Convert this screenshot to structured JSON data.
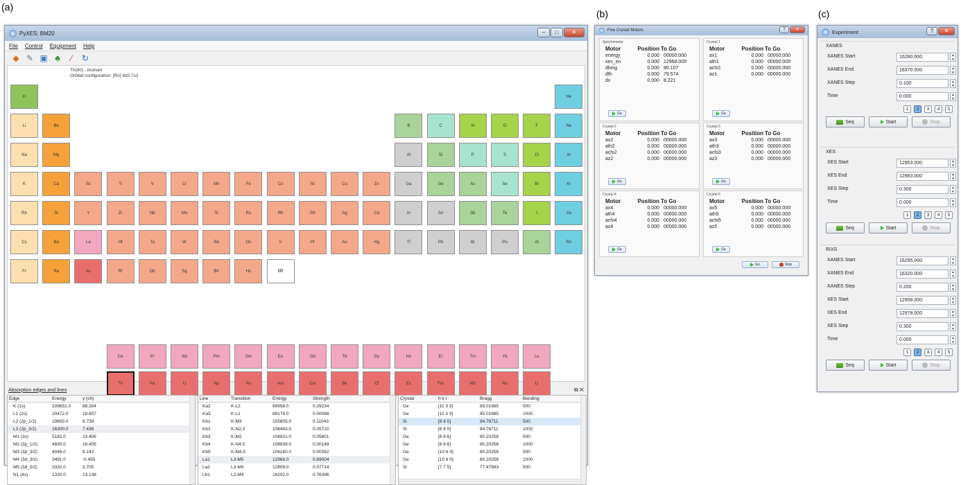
{
  "labels": {
    "a": "(a)",
    "b": "(b)",
    "c": "(c)"
  },
  "main": {
    "title": "PyXES: BM20",
    "menu": [
      "File",
      "Control",
      "Equipment",
      "Help"
    ],
    "info_line1": "Th(90) - thorium",
    "info_line2": "Orbital configuration: [Rn] 6d2 7s2",
    "dock_title": "Absorption edges and lines",
    "colors": {
      "h": "#8fc25a",
      "alkali": "#fde0b0",
      "alkaline": "#f5a23b",
      "tm": "#f4a88a",
      "post": "#cfcfcf",
      "metalloid": "#a9d39b",
      "nonmetal": "#a8e3d0",
      "halogen": "#a7d34a",
      "noble": "#6fcfe0",
      "lan": "#f1a8bf",
      "act": "#e96f6f",
      "sc": "#f1b0a0"
    },
    "elements": [
      {
        "s": "H",
        "r": 0,
        "c": 0,
        "g": "h"
      },
      {
        "s": "He",
        "r": 0,
        "c": 17,
        "g": "noble"
      },
      {
        "s": "Li",
        "r": 1,
        "c": 0,
        "g": "alkali"
      },
      {
        "s": "Be",
        "r": 1,
        "c": 1,
        "g": "alkaline"
      },
      {
        "s": "B",
        "r": 1,
        "c": 12,
        "g": "metalloid"
      },
      {
        "s": "C",
        "r": 1,
        "c": 13,
        "g": "nonmetal"
      },
      {
        "s": "N",
        "r": 1,
        "c": 14,
        "g": "halogen"
      },
      {
        "s": "O",
        "r": 1,
        "c": 15,
        "g": "halogen"
      },
      {
        "s": "F",
        "r": 1,
        "c": 16,
        "g": "halogen"
      },
      {
        "s": "Ne",
        "r": 1,
        "c": 17,
        "g": "noble"
      },
      {
        "s": "Na",
        "r": 2,
        "c": 0,
        "g": "alkali"
      },
      {
        "s": "Mg",
        "r": 2,
        "c": 1,
        "g": "alkaline"
      },
      {
        "s": "Al",
        "r": 2,
        "c": 12,
        "g": "post"
      },
      {
        "s": "Si",
        "r": 2,
        "c": 13,
        "g": "metalloid"
      },
      {
        "s": "P",
        "r": 2,
        "c": 14,
        "g": "nonmetal"
      },
      {
        "s": "S",
        "r": 2,
        "c": 15,
        "g": "nonmetal"
      },
      {
        "s": "Cl",
        "r": 2,
        "c": 16,
        "g": "halogen"
      },
      {
        "s": "Ar",
        "r": 2,
        "c": 17,
        "g": "noble"
      },
      {
        "s": "K",
        "r": 3,
        "c": 0,
        "g": "alkali"
      },
      {
        "s": "Ca",
        "r": 3,
        "c": 1,
        "g": "alkaline"
      },
      {
        "s": "Sc",
        "r": 3,
        "c": 2,
        "g": "tm"
      },
      {
        "s": "Ti",
        "r": 3,
        "c": 3,
        "g": "tm"
      },
      {
        "s": "V",
        "r": 3,
        "c": 4,
        "g": "tm"
      },
      {
        "s": "Cr",
        "r": 3,
        "c": 5,
        "g": "tm"
      },
      {
        "s": "Mn",
        "r": 3,
        "c": 6,
        "g": "tm"
      },
      {
        "s": "Fe",
        "r": 3,
        "c": 7,
        "g": "tm"
      },
      {
        "s": "Co",
        "r": 3,
        "c": 8,
        "g": "tm"
      },
      {
        "s": "Ni",
        "r": 3,
        "c": 9,
        "g": "tm"
      },
      {
        "s": "Cu",
        "r": 3,
        "c": 10,
        "g": "tm"
      },
      {
        "s": "Zn",
        "r": 3,
        "c": 11,
        "g": "tm"
      },
      {
        "s": "Ga",
        "r": 3,
        "c": 12,
        "g": "post"
      },
      {
        "s": "Ge",
        "r": 3,
        "c": 13,
        "g": "metalloid"
      },
      {
        "s": "As",
        "r": 3,
        "c": 14,
        "g": "metalloid"
      },
      {
        "s": "Se",
        "r": 3,
        "c": 15,
        "g": "nonmetal"
      },
      {
        "s": "Br",
        "r": 3,
        "c": 16,
        "g": "halogen"
      },
      {
        "s": "Kr",
        "r": 3,
        "c": 17,
        "g": "noble"
      },
      {
        "s": "Rb",
        "r": 4,
        "c": 0,
        "g": "alkali"
      },
      {
        "s": "Sr",
        "r": 4,
        "c": 1,
        "g": "alkaline"
      },
      {
        "s": "Y",
        "r": 4,
        "c": 2,
        "g": "tm"
      },
      {
        "s": "Zr",
        "r": 4,
        "c": 3,
        "g": "tm"
      },
      {
        "s": "Nb",
        "r": 4,
        "c": 4,
        "g": "tm"
      },
      {
        "s": "Mo",
        "r": 4,
        "c": 5,
        "g": "tm"
      },
      {
        "s": "Tc",
        "r": 4,
        "c": 6,
        "g": "tm"
      },
      {
        "s": "Ru",
        "r": 4,
        "c": 7,
        "g": "tm"
      },
      {
        "s": "Rh",
        "r": 4,
        "c": 8,
        "g": "tm"
      },
      {
        "s": "Pd",
        "r": 4,
        "c": 9,
        "g": "tm"
      },
      {
        "s": "Ag",
        "r": 4,
        "c": 10,
        "g": "tm"
      },
      {
        "s": "Cd",
        "r": 4,
        "c": 11,
        "g": "tm"
      },
      {
        "s": "In",
        "r": 4,
        "c": 12,
        "g": "post"
      },
      {
        "s": "Sn",
        "r": 4,
        "c": 13,
        "g": "post"
      },
      {
        "s": "Sb",
        "r": 4,
        "c": 14,
        "g": "metalloid"
      },
      {
        "s": "Te",
        "r": 4,
        "c": 15,
        "g": "metalloid"
      },
      {
        "s": "I",
        "r": 4,
        "c": 16,
        "g": "halogen"
      },
      {
        "s": "Xe",
        "r": 4,
        "c": 17,
        "g": "noble"
      },
      {
        "s": "Cs",
        "r": 5,
        "c": 0,
        "g": "alkali"
      },
      {
        "s": "Ba",
        "r": 5,
        "c": 1,
        "g": "alkaline"
      },
      {
        "s": "La",
        "r": 5,
        "c": 2,
        "g": "lan"
      },
      {
        "s": "Hf",
        "r": 5,
        "c": 3,
        "g": "tm"
      },
      {
        "s": "Ta",
        "r": 5,
        "c": 4,
        "g": "tm"
      },
      {
        "s": "W",
        "r": 5,
        "c": 5,
        "g": "tm"
      },
      {
        "s": "Re",
        "r": 5,
        "c": 6,
        "g": "tm"
      },
      {
        "s": "Os",
        "r": 5,
        "c": 7,
        "g": "tm"
      },
      {
        "s": "Ir",
        "r": 5,
        "c": 8,
        "g": "tm"
      },
      {
        "s": "Pt",
        "r": 5,
        "c": 9,
        "g": "tm"
      },
      {
        "s": "Au",
        "r": 5,
        "c": 10,
        "g": "tm"
      },
      {
        "s": "Hg",
        "r": 5,
        "c": 11,
        "g": "tm"
      },
      {
        "s": "Tl",
        "r": 5,
        "c": 12,
        "g": "post"
      },
      {
        "s": "Pb",
        "r": 5,
        "c": 13,
        "g": "post"
      },
      {
        "s": "Bi",
        "r": 5,
        "c": 14,
        "g": "post"
      },
      {
        "s": "Po",
        "r": 5,
        "c": 15,
        "g": "post"
      },
      {
        "s": "At",
        "r": 5,
        "c": 16,
        "g": "metalloid"
      },
      {
        "s": "Rn",
        "r": 5,
        "c": 17,
        "g": "noble"
      },
      {
        "s": "Fr",
        "r": 6,
        "c": 0,
        "g": "alkali"
      },
      {
        "s": "Ra",
        "r": 6,
        "c": 1,
        "g": "alkaline"
      },
      {
        "s": "Ac",
        "r": 6,
        "c": 2,
        "g": "act"
      },
      {
        "s": "Rf",
        "r": 6,
        "c": 3,
        "g": "tm"
      },
      {
        "s": "Db",
        "r": 6,
        "c": 4,
        "g": "tm"
      },
      {
        "s": "Sg",
        "r": 6,
        "c": 5,
        "g": "tm"
      },
      {
        "s": "Bh",
        "r": 6,
        "c": 6,
        "g": "tm"
      },
      {
        "s": "Hs",
        "r": 6,
        "c": 7,
        "g": "tm"
      },
      {
        "s": "Mt",
        "r": 6,
        "c": 8,
        "g": "empty"
      },
      {
        "s": "Ce",
        "r": 7,
        "c": 3,
        "g": "lan"
      },
      {
        "s": "Pr",
        "r": 7,
        "c": 4,
        "g": "lan"
      },
      {
        "s": "Nd",
        "r": 7,
        "c": 5,
        "g": "lan"
      },
      {
        "s": "Pm",
        "r": 7,
        "c": 6,
        "g": "lan"
      },
      {
        "s": "Sm",
        "r": 7,
        "c": 7,
        "g": "lan"
      },
      {
        "s": "Eu",
        "r": 7,
        "c": 8,
        "g": "lan"
      },
      {
        "s": "Gd",
        "r": 7,
        "c": 9,
        "g": "lan"
      },
      {
        "s": "Tb",
        "r": 7,
        "c": 10,
        "g": "lan"
      },
      {
        "s": "Dy",
        "r": 7,
        "c": 11,
        "g": "lan"
      },
      {
        "s": "Ho",
        "r": 7,
        "c": 12,
        "g": "lan"
      },
      {
        "s": "Er",
        "r": 7,
        "c": 13,
        "g": "lan"
      },
      {
        "s": "Tm",
        "r": 7,
        "c": 14,
        "g": "lan"
      },
      {
        "s": "Yb",
        "r": 7,
        "c": 15,
        "g": "lan"
      },
      {
        "s": "Lu",
        "r": 7,
        "c": 16,
        "g": "lan"
      },
      {
        "s": "Th",
        "r": 8,
        "c": 3,
        "g": "act",
        "sel": true
      },
      {
        "s": "Pa",
        "r": 8,
        "c": 4,
        "g": "act"
      },
      {
        "s": "U",
        "r": 8,
        "c": 5,
        "g": "act"
      },
      {
        "s": "Np",
        "r": 8,
        "c": 6,
        "g": "act"
      },
      {
        "s": "Pu",
        "r": 8,
        "c": 7,
        "g": "act"
      },
      {
        "s": "Am",
        "r": 8,
        "c": 8,
        "g": "act"
      },
      {
        "s": "Cm",
        "r": 8,
        "c": 9,
        "g": "act"
      },
      {
        "s": "Bk",
        "r": 8,
        "c": 10,
        "g": "act"
      },
      {
        "s": "Cf",
        "r": 8,
        "c": 11,
        "g": "act"
      },
      {
        "s": "Es",
        "r": 8,
        "c": 12,
        "g": "act"
      },
      {
        "s": "Fm",
        "r": 8,
        "c": 13,
        "g": "act"
      },
      {
        "s": "Md",
        "r": 8,
        "c": 14,
        "g": "act"
      },
      {
        "s": "No",
        "r": 8,
        "c": 15,
        "g": "act"
      },
      {
        "s": "Lr",
        "r": 8,
        "c": 16,
        "g": "act"
      }
    ],
    "edges": {
      "headers": [
        "Edge",
        "Energy",
        "γ (ch)"
      ],
      "rows": [
        [
          "K (1s)",
          "109651.0",
          "88.354"
        ],
        [
          "L1 (2s)",
          "20472.0",
          "18.807"
        ],
        [
          "L2 (2p_1/2)",
          "19693.0",
          "8.739"
        ],
        [
          "L3 (2p_3/2)",
          "16300.0",
          "7.436"
        ],
        [
          "M1 (3s)",
          "5182.0",
          "23.406"
        ],
        [
          "M2 (3p_1/2)",
          "4830.0",
          "16.405"
        ],
        [
          "M3 (3p_3/2)",
          "4046.0",
          "9.143"
        ],
        [
          "M4 (3d_3/2)",
          "3491.0",
          "-0.455"
        ],
        [
          "M5 (3d_5/2)",
          "3332.0",
          "3.705"
        ],
        [
          "N1 (4s)",
          "1330.0",
          "13.136"
        ]
      ]
    },
    "lines": {
      "headers": [
        "Line",
        "Transition",
        "Energy",
        "Strength"
      ],
      "rows": [
        [
          "Ka2",
          "K-L2",
          "89958.0",
          "0.29234"
        ],
        [
          "Ka3",
          "K-L1",
          "89179.0",
          "0.00088"
        ],
        [
          "Kb1",
          "K-M3",
          "105605.0",
          "0.11043"
        ],
        [
          "Kb2",
          "K-N2,3",
          "108483.0",
          "0.05710"
        ],
        [
          "Kb3",
          "K-M2",
          "104821.0",
          "0.05801"
        ],
        [
          "Kb4",
          "K-N4,5",
          "108939.0",
          "0.00149"
        ],
        [
          "Kb5",
          "K-M4,5",
          "106160.0",
          "0.00392"
        ],
        [
          "La1",
          "L3-M5",
          "12968.0",
          "0.69004"
        ],
        [
          "La2",
          "L3-M4",
          "12809.0",
          "0.07714"
        ],
        [
          "Lb1",
          "L2-M4",
          "16202.0",
          "0.76396"
        ]
      ]
    },
    "crystals": {
      "headers": [
        "Crystal",
        "h k l",
        "Bragg",
        "Bending"
      ],
      "rows": [
        [
          "Ge",
          "[11 3 3]",
          "85.01985",
          "500"
        ],
        [
          "Ge",
          "[11 3 3]",
          "85.01985",
          "1000"
        ],
        [
          "Si",
          "[8 8 0]",
          "84.78711",
          "500"
        ],
        [
          "Si",
          "[8 8 0]",
          "84.78711",
          "1000"
        ],
        [
          "Ge",
          "[8 6 6]",
          "80.20258",
          "500"
        ],
        [
          "Ge",
          "[8 6 6]",
          "80.20258",
          "1000"
        ],
        [
          "Ge",
          "[10 6 0]",
          "80.20258",
          "500"
        ],
        [
          "Ge",
          "[10 6 0]",
          "80.20258",
          "1000"
        ],
        [
          "Si",
          "[7 7 5]",
          "77.47983",
          "500"
        ]
      ]
    }
  },
  "motors": {
    "title": "Five Crystal Motors",
    "headers": [
      "Motor",
      "Position",
      "To Go"
    ],
    "go": "Go",
    "stop": "Stop",
    "groups": [
      {
        "name": "Spectrometer",
        "rows": [
          [
            "energy",
            "0.000",
            "00000.000"
          ],
          [
            "xes_en",
            "0.000",
            "12968.000"
          ],
          [
            "dlong",
            "0.000",
            "90.107"
          ],
          [
            "dth",
            "0.000",
            "79.574"
          ],
          [
            "dx",
            "0.000",
            "8.221"
          ]
        ]
      },
      {
        "name": "Crystal 1",
        "rows": [
          [
            "ax1",
            "0.000",
            "00000.000"
          ],
          [
            "ath1",
            "0.000",
            "00000.000"
          ],
          [
            "achi1",
            "0.000",
            "00000.000"
          ],
          [
            "az1",
            "0.000",
            "00000.000"
          ]
        ]
      },
      {
        "name": "Crystal 2",
        "rows": [
          [
            "ax2",
            "0.000",
            "00000.000"
          ],
          [
            "ath2",
            "0.000",
            "00000.000"
          ],
          [
            "achi2",
            "0.000",
            "00000.000"
          ],
          [
            "az2",
            "0.000",
            "00000.000"
          ]
        ]
      },
      {
        "name": "Crystal 3",
        "rows": [
          [
            "ax3",
            "0.000",
            "00000.000"
          ],
          [
            "ath3",
            "0.000",
            "00000.000"
          ],
          [
            "achi3",
            "0.000",
            "00000.000"
          ],
          [
            "az3",
            "0.000",
            "00000.000"
          ]
        ]
      },
      {
        "name": "Crystal 4",
        "rows": [
          [
            "ax4",
            "0.000",
            "00000.000"
          ],
          [
            "ath4",
            "0.000",
            "00000.000"
          ],
          [
            "achi4",
            "0.000",
            "00000.000"
          ],
          [
            "az4",
            "0.000",
            "00000.000"
          ]
        ]
      },
      {
        "name": "Crystal 5",
        "rows": [
          [
            "ax5",
            "0.000",
            "00000.000"
          ],
          [
            "ath5",
            "0.000",
            "00000.000"
          ],
          [
            "achi5",
            "0.000",
            "00000.000"
          ],
          [
            "az5",
            "0.000",
            "00000.000"
          ]
        ]
      }
    ]
  },
  "experiment": {
    "title": "Experiment",
    "seq": "Seq",
    "start": "Start",
    "stop": "Stop",
    "nums": [
      "1",
      "2",
      "3",
      "4",
      "5"
    ],
    "sections": [
      {
        "name": "XANES",
        "fields": [
          [
            "XANES Start",
            "16280.000"
          ],
          [
            "XANES End",
            "16370.000"
          ],
          [
            "XANES Step",
            "0.100"
          ],
          [
            "Time",
            "0.000"
          ]
        ],
        "sel": 2
      },
      {
        "name": "XES",
        "fields": [
          [
            "XES Start",
            "12953.000"
          ],
          [
            "XES End",
            "12983.000"
          ],
          [
            "XES Step",
            "0.300"
          ],
          [
            "Time",
            "0.000"
          ]
        ],
        "sel": 2
      },
      {
        "name": "RIXS",
        "fields": [
          [
            "XANES Start",
            "16295.000"
          ],
          [
            "XANES End",
            "16320.000"
          ],
          [
            "XANES Step",
            "0.200"
          ],
          [
            "XES Start",
            "12958.000"
          ],
          [
            "XES End",
            "12978.000"
          ],
          [
            "XES Step",
            "0.300"
          ],
          [
            "Time",
            "0.000"
          ]
        ],
        "sel": 2
      }
    ]
  }
}
